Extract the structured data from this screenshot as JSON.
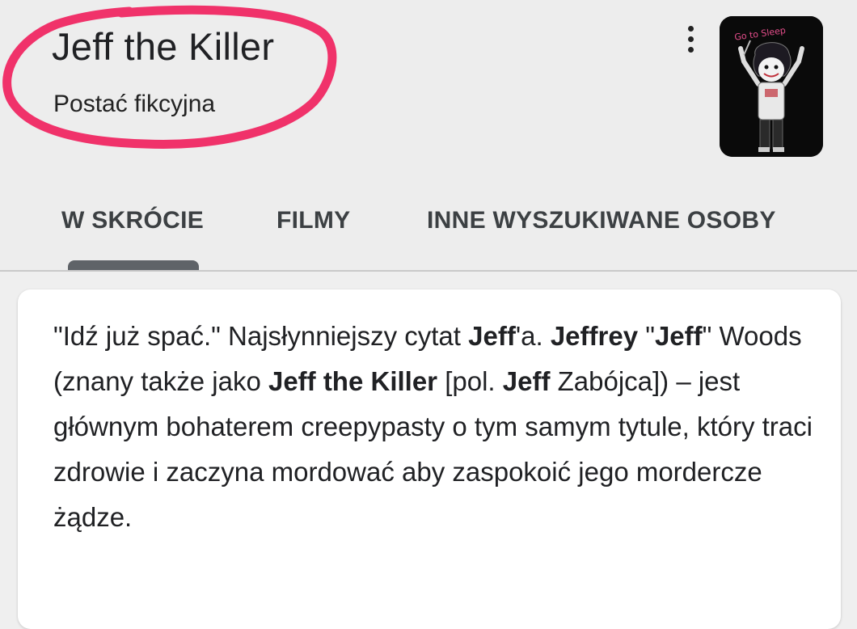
{
  "entity": {
    "title": "Jeff the Killer",
    "subtitle": "Postać fikcyjna",
    "more_icon": "more-vertical-icon",
    "thumbnail_caption": "Go to Sleep"
  },
  "tabs": [
    {
      "label": "W SKRÓCIE",
      "active": true
    },
    {
      "label": "FILMY",
      "active": false
    },
    {
      "label": "INNE WYSZUKIWANE OSOBY",
      "active": false
    }
  ],
  "description": [
    {
      "text": "\"Idź już spać.\" Najsłynniejszy cytat ",
      "bold": false
    },
    {
      "text": "Jeff",
      "bold": true
    },
    {
      "text": "'a. ",
      "bold": false
    },
    {
      "text": "Jeffrey",
      "bold": true
    },
    {
      "text": " \"",
      "bold": false
    },
    {
      "text": "Jeff",
      "bold": true
    },
    {
      "text": "\" Woods (znany także jako ",
      "bold": false
    },
    {
      "text": "Jeff the Killer",
      "bold": true
    },
    {
      "text": " [pol. ",
      "bold": false
    },
    {
      "text": "Jeff",
      "bold": true
    },
    {
      "text": " Zabójca]) – jest głównym bohaterem creepypasty o tym samym tytule, który traci zdrowie i zaczyna mordować aby zaspokoić jego mordercze żądze.",
      "bold": false
    }
  ],
  "colors": {
    "highlight": "#f0326a",
    "header_bg": "#ededed",
    "card_bg": "#ffffff",
    "tab_text": "#3c4043",
    "indicator": "#5f6368"
  }
}
